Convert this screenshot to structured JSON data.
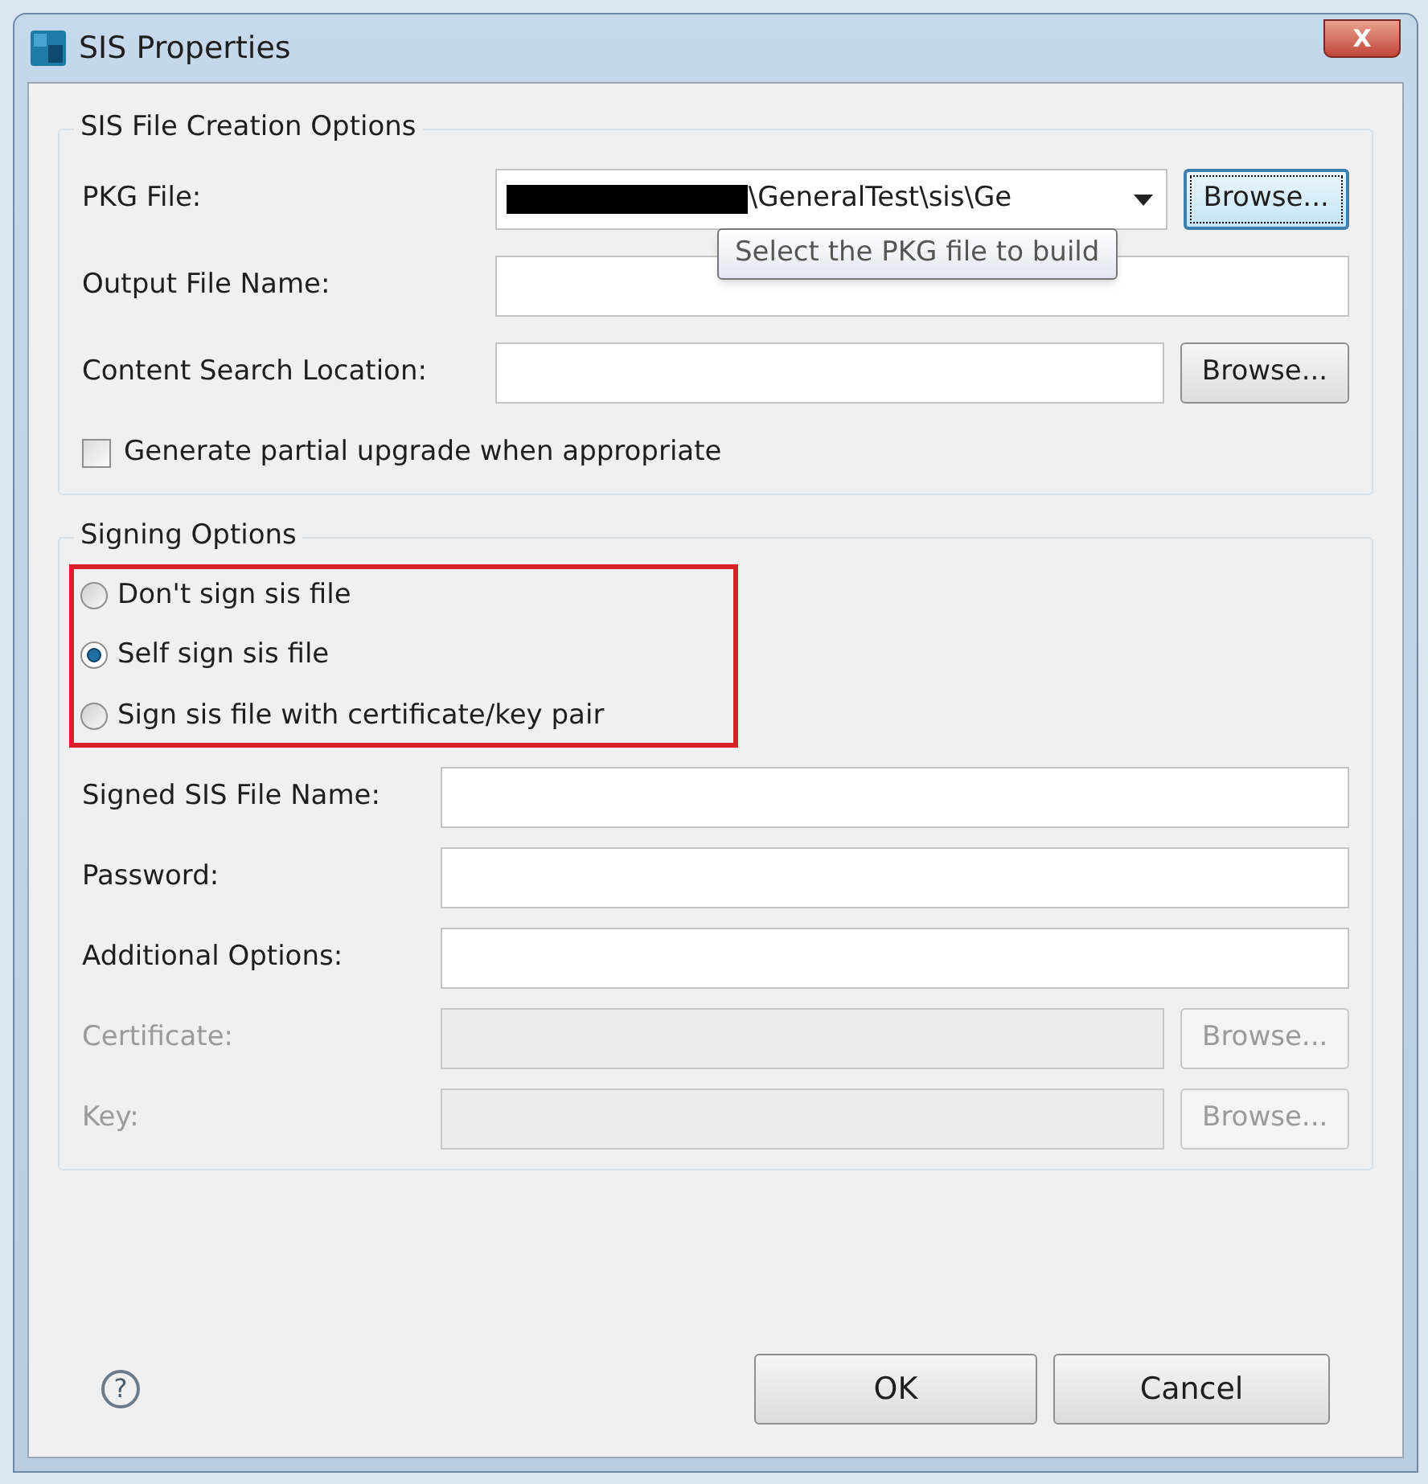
{
  "window": {
    "title": "SIS Properties",
    "close": "X"
  },
  "creation_group": {
    "title": "SIS File Creation Options",
    "pkg_file": {
      "label": "PKG File:",
      "value": "\\GeneralTest\\sis\\Ge",
      "browse": "Browse...",
      "redacted": true
    },
    "tooltip": "Select the PKG file to build",
    "output_file": {
      "label": "Output File Name:"
    },
    "content_search": {
      "label": "Content Search Location:",
      "browse": "Browse..."
    },
    "partial_upgrade": {
      "label": "Generate partial upgrade when appropriate",
      "checked": false
    }
  },
  "signing_group": {
    "title": "Signing Options",
    "options": [
      {
        "label": "Don't sign sis file",
        "selected": false
      },
      {
        "label": "Self sign sis file",
        "selected": true
      },
      {
        "label": "Sign sis file with certificate/key pair",
        "selected": false
      }
    ],
    "fields": [
      {
        "label": "Signed SIS File Name:",
        "disabled": false
      },
      {
        "label": "Password:",
        "disabled": false
      },
      {
        "label": "Additional Options:",
        "disabled": false
      },
      {
        "label": "Certificate:",
        "disabled": true,
        "browse": "Browse..."
      },
      {
        "label": "Key:",
        "disabled": true,
        "browse": "Browse..."
      }
    ]
  },
  "help": "?",
  "buttons": [
    "OK",
    "Cancel"
  ]
}
